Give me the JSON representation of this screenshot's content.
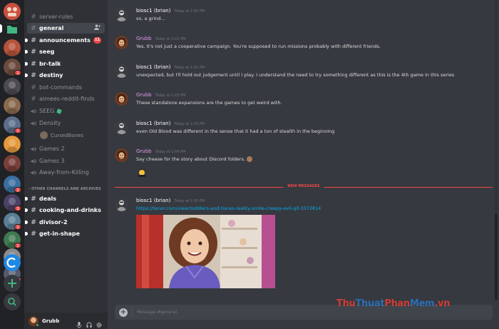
{
  "rail": {
    "servers": [
      {
        "name": "server-1",
        "color": "#b5533c",
        "badge": ""
      },
      {
        "name": "server-2",
        "color": "#6b4b3e",
        "badge": "1"
      },
      {
        "name": "server-3",
        "color": "#4d4a52",
        "badge": ""
      },
      {
        "name": "server-4",
        "color": "#8a6a4f",
        "badge": ""
      },
      {
        "name": "server-5",
        "color": "#5c6f8a",
        "badge": "1"
      },
      {
        "name": "server-6",
        "color": "#e69a3d",
        "badge": ""
      },
      {
        "name": "server-7",
        "color": "#7b3f3a",
        "badge": ""
      },
      {
        "name": "server-8",
        "color": "#3a6f9f",
        "badge": "2"
      },
      {
        "name": "server-9",
        "color": "#4b4266",
        "badge": "3"
      },
      {
        "name": "server-10",
        "color": "#5a7f96",
        "badge": "1"
      },
      {
        "name": "server-11",
        "color": "#3f7a4f",
        "badge": "1"
      },
      {
        "name": "server-12",
        "color": "#8b8b8b",
        "badge": "1"
      },
      {
        "name": "server-13",
        "color": "#565a6e",
        "badge": "25"
      },
      {
        "name": "server-14",
        "color": "#1e88e5",
        "badge": ""
      }
    ],
    "add_server_glyph": "+",
    "explore_glyph": "⚲"
  },
  "sidebar": {
    "channels": [
      {
        "label": "server-rules",
        "type": "text",
        "state": "normal"
      },
      {
        "label": "general",
        "type": "text",
        "state": "active"
      },
      {
        "label": "announcements",
        "type": "text",
        "state": "unread",
        "badge": "11"
      },
      {
        "label": "seeg",
        "type": "text",
        "state": "unread"
      },
      {
        "label": "br-talk",
        "type": "text",
        "state": "unread"
      },
      {
        "label": "destiny",
        "type": "text",
        "state": "unread"
      },
      {
        "label": "bot-commands",
        "type": "text",
        "state": "normal"
      },
      {
        "label": "aimees-reddit-finds",
        "type": "text",
        "state": "normal"
      },
      {
        "label": "SEEG",
        "type": "voice",
        "state": "normal"
      },
      {
        "label": "Density",
        "type": "voice",
        "state": "normal"
      },
      {
        "label": "Games 2",
        "type": "voice",
        "state": "normal"
      },
      {
        "label": "Games 3",
        "type": "voice",
        "state": "normal"
      },
      {
        "label": "Away-from-Killing",
        "type": "voice",
        "state": "normal"
      }
    ],
    "voice_user": "CursedBones",
    "category": "OTHER CHANNELS AND ARCHIVES",
    "other_channels": [
      {
        "label": "deals",
        "state": "unread"
      },
      {
        "label": "cooking-and-drinks",
        "state": "unread"
      },
      {
        "label": "divisor-2",
        "state": "unread"
      },
      {
        "label": "get-in-shape",
        "state": "unread"
      }
    ]
  },
  "user_panel": {
    "username": "Grubb"
  },
  "chat": {
    "messages": [
      {
        "author": "biosc1 (brian)",
        "author_class": "brian",
        "time": "Today at 1:00 PM",
        "text": "so, a grind..."
      },
      {
        "author": "Grubb",
        "author_class": "grubb",
        "time": "Today at 1:01 PM",
        "text": "Yes. It's not just a cooperative campaign. You're supposed to run missions probably with different friends."
      },
      {
        "author": "biosc1 (brian)",
        "author_class": "brian",
        "time": "Today at 1:01 PM",
        "text": "unexpected, but I'll hold out judgement until I play.  I understand the need to try something different as this is the 4th game in this series"
      },
      {
        "author": "Grubb",
        "author_class": "grubb",
        "time": "Today at 1:03 PM",
        "text": "These standalone expansions are the games to get weird with."
      },
      {
        "author": "biosc1 (brian)",
        "author_class": "brian",
        "time": "Today at 1:03 PM",
        "text": "even Old Blood was different in the sense that it had a ton of stealth in the beginning"
      },
      {
        "author": "Grubb",
        "author_class": "grubb",
        "time": "Today at 1:04 PM",
        "text": "Say cheese for the story about Discord folders."
      },
      {
        "author": "biosc1 (brian)",
        "author_class": "brian",
        "time": "Today at 1:05 PM",
        "text": "https://tenor.com/view/toddlers-and-tiaras-reality-smile-creepy-evil-gif-3372814"
      }
    ],
    "divider": "NEW MESSAGES",
    "composer_placeholder": "Message #general"
  },
  "watermark": {
    "part1": "Thu",
    "part2": "Thuat",
    "part3": "Phan",
    "part4": "Mem",
    "part5": ".vn"
  }
}
